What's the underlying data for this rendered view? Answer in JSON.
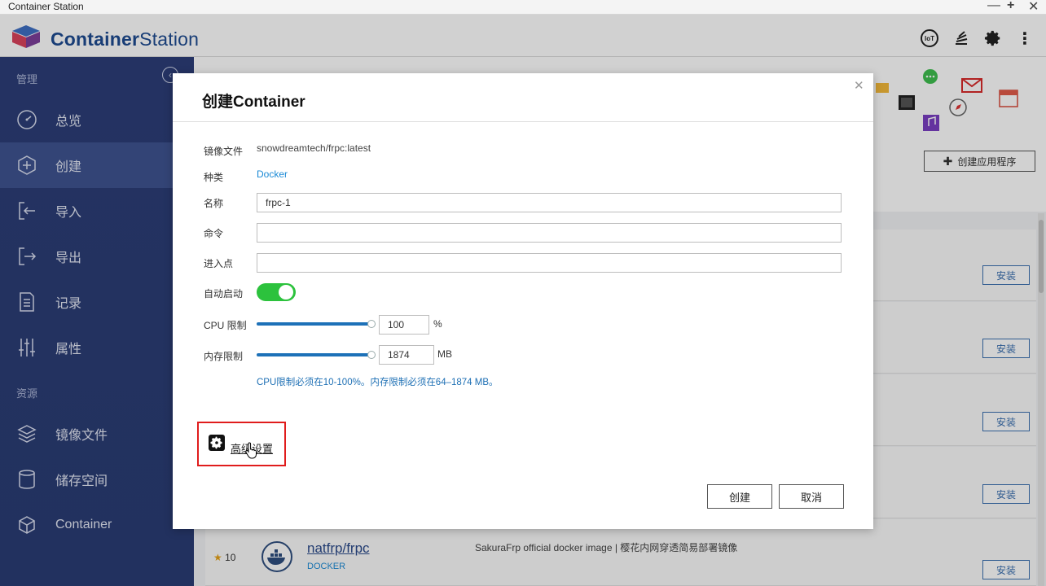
{
  "window": {
    "title": "Container Station"
  },
  "brand": {
    "part1": "Container",
    "part2": "Station"
  },
  "header_icons": {
    "iot_label": "IoT"
  },
  "sidebar": {
    "section_manage": "管理",
    "section_resources": "资源",
    "items": [
      {
        "label": "总览",
        "icon": "dashboard-icon"
      },
      {
        "label": "创建",
        "icon": "plus-hex-icon",
        "active": true
      },
      {
        "label": "导入",
        "icon": "import-icon"
      },
      {
        "label": "导出",
        "icon": "export-icon"
      },
      {
        "label": "记录",
        "icon": "log-icon"
      },
      {
        "label": "属性",
        "icon": "sliders-icon"
      }
    ],
    "resource_items": [
      {
        "label": "镜像文件",
        "icon": "layers-icon"
      },
      {
        "label": "储存空间",
        "icon": "database-icon"
      },
      {
        "label": "Container",
        "icon": "cube-icon"
      }
    ]
  },
  "main": {
    "create_app_label": "创建应用程序",
    "install_label": "安装",
    "last_row": {
      "stars": "10",
      "name": "natfrp/frpc",
      "type": "DOCKER",
      "description": "SakuraFrp official docker image | 樱花内网穿透简易部署镜像"
    }
  },
  "modal": {
    "title": "创建Container",
    "image_label": "镜像文件",
    "image_value": "snowdreamtech/frpc:latest",
    "type_label": "种类",
    "type_value": "Docker",
    "name_label": "名称",
    "name_value": "frpc-1",
    "command_label": "命令",
    "command_value": "",
    "entrypoint_label": "进入点",
    "entrypoint_value": "",
    "autostart_label": "自动启动",
    "autostart_on": true,
    "cpu_label": "CPU 限制",
    "cpu_value": "100",
    "cpu_unit": "%",
    "mem_label": "内存限制",
    "mem_value": "1874",
    "mem_unit": "MB",
    "hint": "CPU限制必须在10-100%。内存限制必须在64–1874 MB。",
    "advanced_label": "高级设置",
    "create_label": "创建",
    "cancel_label": "取消"
  },
  "colors": {
    "sidebar_bg": "#2c3e78",
    "brand": "#1e4b91",
    "toggle_on": "#2cc23d",
    "highlight_box": "#e01c1c",
    "link": "#1b8ad6"
  }
}
